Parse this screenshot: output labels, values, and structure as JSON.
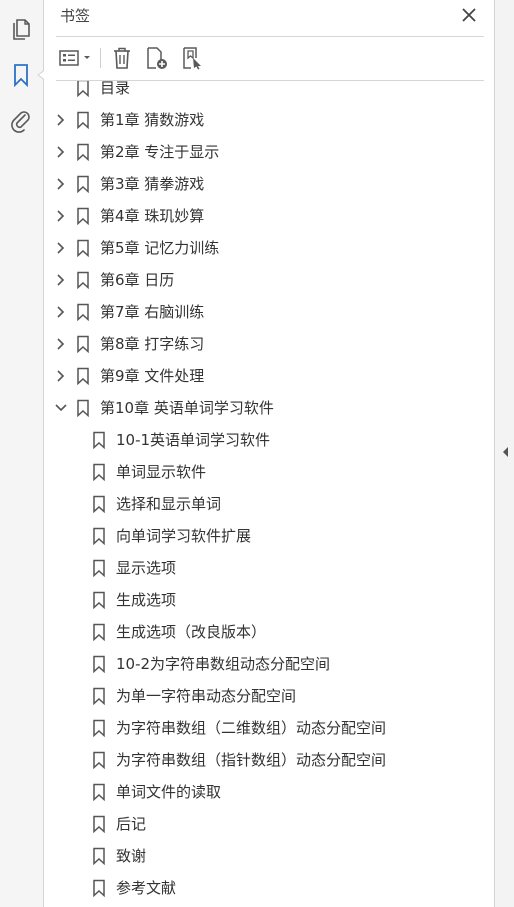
{
  "rail": {
    "icons": [
      "pages-icon",
      "bookmark-icon",
      "attachment-icon"
    ]
  },
  "panel": {
    "title": "书签",
    "close_icon": "close-icon"
  },
  "toolbar": {
    "options_icon": "list-options-icon",
    "delete_icon": "trash-icon",
    "new_bookmark_icon": "new-bookmark-icon",
    "bookmark_from_selection_icon": "bookmark-from-selection-icon"
  },
  "tree": {
    "items": [
      {
        "label": "目录",
        "level": 0,
        "expandable": false
      },
      {
        "label": "第1章  猜数游戏",
        "level": 0,
        "expandable": true,
        "expanded": false
      },
      {
        "label": "第2章  专注于显示",
        "level": 0,
        "expandable": true,
        "expanded": false
      },
      {
        "label": "第3章  猜拳游戏",
        "level": 0,
        "expandable": true,
        "expanded": false
      },
      {
        "label": "第4章  珠玑妙算",
        "level": 0,
        "expandable": true,
        "expanded": false
      },
      {
        "label": "第5章  记忆力训练",
        "level": 0,
        "expandable": true,
        "expanded": false
      },
      {
        "label": "第6章  日历",
        "level": 0,
        "expandable": true,
        "expanded": false
      },
      {
        "label": "第7章  右脑训练",
        "level": 0,
        "expandable": true,
        "expanded": false
      },
      {
        "label": "第8章  打字练习",
        "level": 0,
        "expandable": true,
        "expanded": false
      },
      {
        "label": "第9章  文件处理",
        "level": 0,
        "expandable": true,
        "expanded": false
      },
      {
        "label": "第10章  英语单词学习软件",
        "level": 0,
        "expandable": true,
        "expanded": true
      },
      {
        "label": "10-1英语单词学习软件",
        "level": 1,
        "expandable": false
      },
      {
        "label": "单词显示软件",
        "level": 1,
        "expandable": false
      },
      {
        "label": "选择和显示单词",
        "level": 1,
        "expandable": false
      },
      {
        "label": "向单词学习软件扩展",
        "level": 1,
        "expandable": false
      },
      {
        "label": "显示选项",
        "level": 1,
        "expandable": false
      },
      {
        "label": "生成选项",
        "level": 1,
        "expandable": false
      },
      {
        "label": "生成选项（改良版本）",
        "level": 1,
        "expandable": false
      },
      {
        "label": "10-2为字符串数组动态分配空间",
        "level": 1,
        "expandable": false
      },
      {
        "label": "为单一字符串动态分配空间",
        "level": 1,
        "expandable": false
      },
      {
        "label": "为字符串数组（二维数组）动态分配空间",
        "level": 1,
        "expandable": false
      },
      {
        "label": "为字符串数组（指针数组）动态分配空间",
        "level": 1,
        "expandable": false
      },
      {
        "label": "单词文件的读取",
        "level": 1,
        "expandable": false
      },
      {
        "label": "后记",
        "level": 1,
        "expandable": false
      },
      {
        "label": "致谢",
        "level": 1,
        "expandable": false
      },
      {
        "label": "参考文献",
        "level": 1,
        "expandable": false
      }
    ]
  },
  "colors": {
    "accent": "#2d72c8",
    "icon": "#5a5a5a",
    "text": "#333333"
  }
}
